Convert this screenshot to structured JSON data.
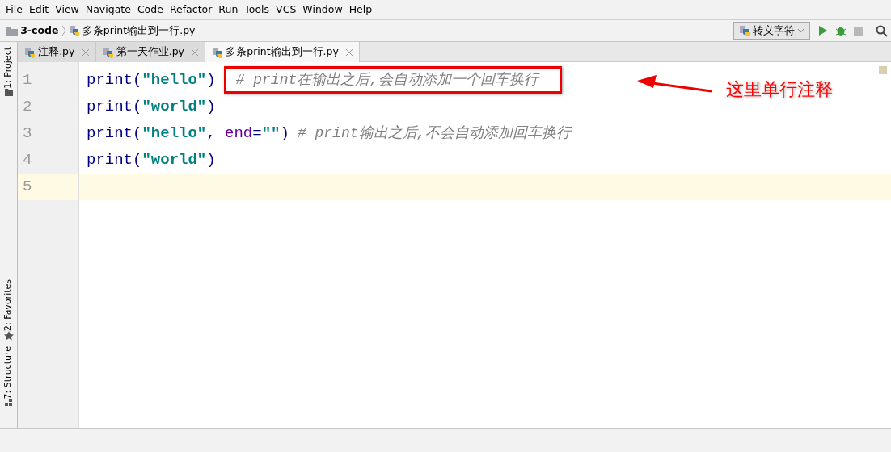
{
  "menu": [
    "File",
    "Edit",
    "View",
    "Navigate",
    "Code",
    "Refactor",
    "Run",
    "Tools",
    "VCS",
    "Window",
    "Help"
  ],
  "breadcrumb": {
    "project": "3-code",
    "file": "多条print输出到一行.py"
  },
  "run_config": {
    "label": "转义字符"
  },
  "tabs": [
    {
      "label": "注释.py",
      "selected": false
    },
    {
      "label": "第一天作业.py",
      "selected": false
    },
    {
      "label": "多条print输出到一行.py",
      "selected": true
    }
  ],
  "tool_windows": {
    "left_top": [
      {
        "label": "1: Project"
      }
    ],
    "left_bottom": [
      {
        "label": "2: Favorites"
      },
      {
        "label": "7: Structure"
      }
    ]
  },
  "lines": [
    {
      "number": "1",
      "current": false,
      "tokens": [
        {
          "kind": "func",
          "text": "print("
        },
        {
          "kind": "string",
          "text": "\"hello\""
        },
        {
          "kind": "func",
          "text": ")"
        },
        {
          "kind": "comment",
          "text": "# print在输出之后,会自动添加一个回车换行",
          "boxed": true
        }
      ]
    },
    {
      "number": "2",
      "current": false,
      "tokens": [
        {
          "kind": "func",
          "text": "print("
        },
        {
          "kind": "string",
          "text": "\"world\""
        },
        {
          "kind": "func",
          "text": ")"
        }
      ]
    },
    {
      "number": "3",
      "current": false,
      "tokens": [
        {
          "kind": "func",
          "text": "print("
        },
        {
          "kind": "string",
          "text": "\"hello\""
        },
        {
          "kind": "func",
          "text": ", "
        },
        {
          "kind": "keyword",
          "text": "end"
        },
        {
          "kind": "func",
          "text": "="
        },
        {
          "kind": "string",
          "text": "\"\""
        },
        {
          "kind": "func",
          "text": ")"
        },
        {
          "kind": "comment",
          "text": "# print输出之后,不会自动添加回车换行",
          "boxed": false
        }
      ]
    },
    {
      "number": "4",
      "current": false,
      "tokens": [
        {
          "kind": "func",
          "text": "print("
        },
        {
          "kind": "string",
          "text": "\"world\""
        },
        {
          "kind": "func",
          "text": ")"
        }
      ]
    },
    {
      "number": "5",
      "current": true
    }
  ],
  "callout": {
    "text": "这里单行注释"
  }
}
